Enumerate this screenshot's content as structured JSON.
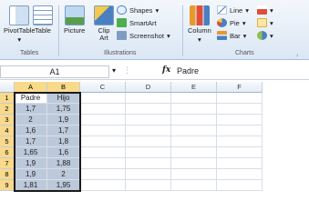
{
  "ribbon": {
    "tables": {
      "pivottable": "PivotTable",
      "table": "Table",
      "group": "Tables"
    },
    "illustrations": {
      "picture": "Picture",
      "clipart": "Clip Art",
      "shapes": "Shapes",
      "smartart": "SmartArt",
      "screenshot": "Screenshot",
      "group": "Illustrations"
    },
    "charts": {
      "column": "Column",
      "line": "Line",
      "pie": "Pie",
      "bar": "Bar",
      "group": "Charts"
    }
  },
  "formula_bar": {
    "name_box": "A1",
    "fx": "fx",
    "content": "Padre"
  },
  "grid": {
    "columns": [
      "A",
      "B",
      "C",
      "D",
      "E",
      "F"
    ],
    "rows": [
      "1",
      "2",
      "3",
      "4",
      "5",
      "6",
      "7",
      "8",
      "9"
    ],
    "data": [
      [
        "Padre",
        "Hijo"
      ],
      [
        "1,7",
        "1,75"
      ],
      [
        "2",
        "1,9"
      ],
      [
        "1,6",
        "1,7"
      ],
      [
        "1,7",
        "1,8"
      ],
      [
        "1,65",
        "1,6"
      ],
      [
        "1,9",
        "1,88"
      ],
      [
        "1,9",
        "2"
      ],
      [
        "1,81",
        "1,95"
      ]
    ]
  },
  "colors": {
    "accent_selection": "#f9d98a",
    "selected_cell": "#bcc9db",
    "header_bg": "#e4ecf6"
  }
}
